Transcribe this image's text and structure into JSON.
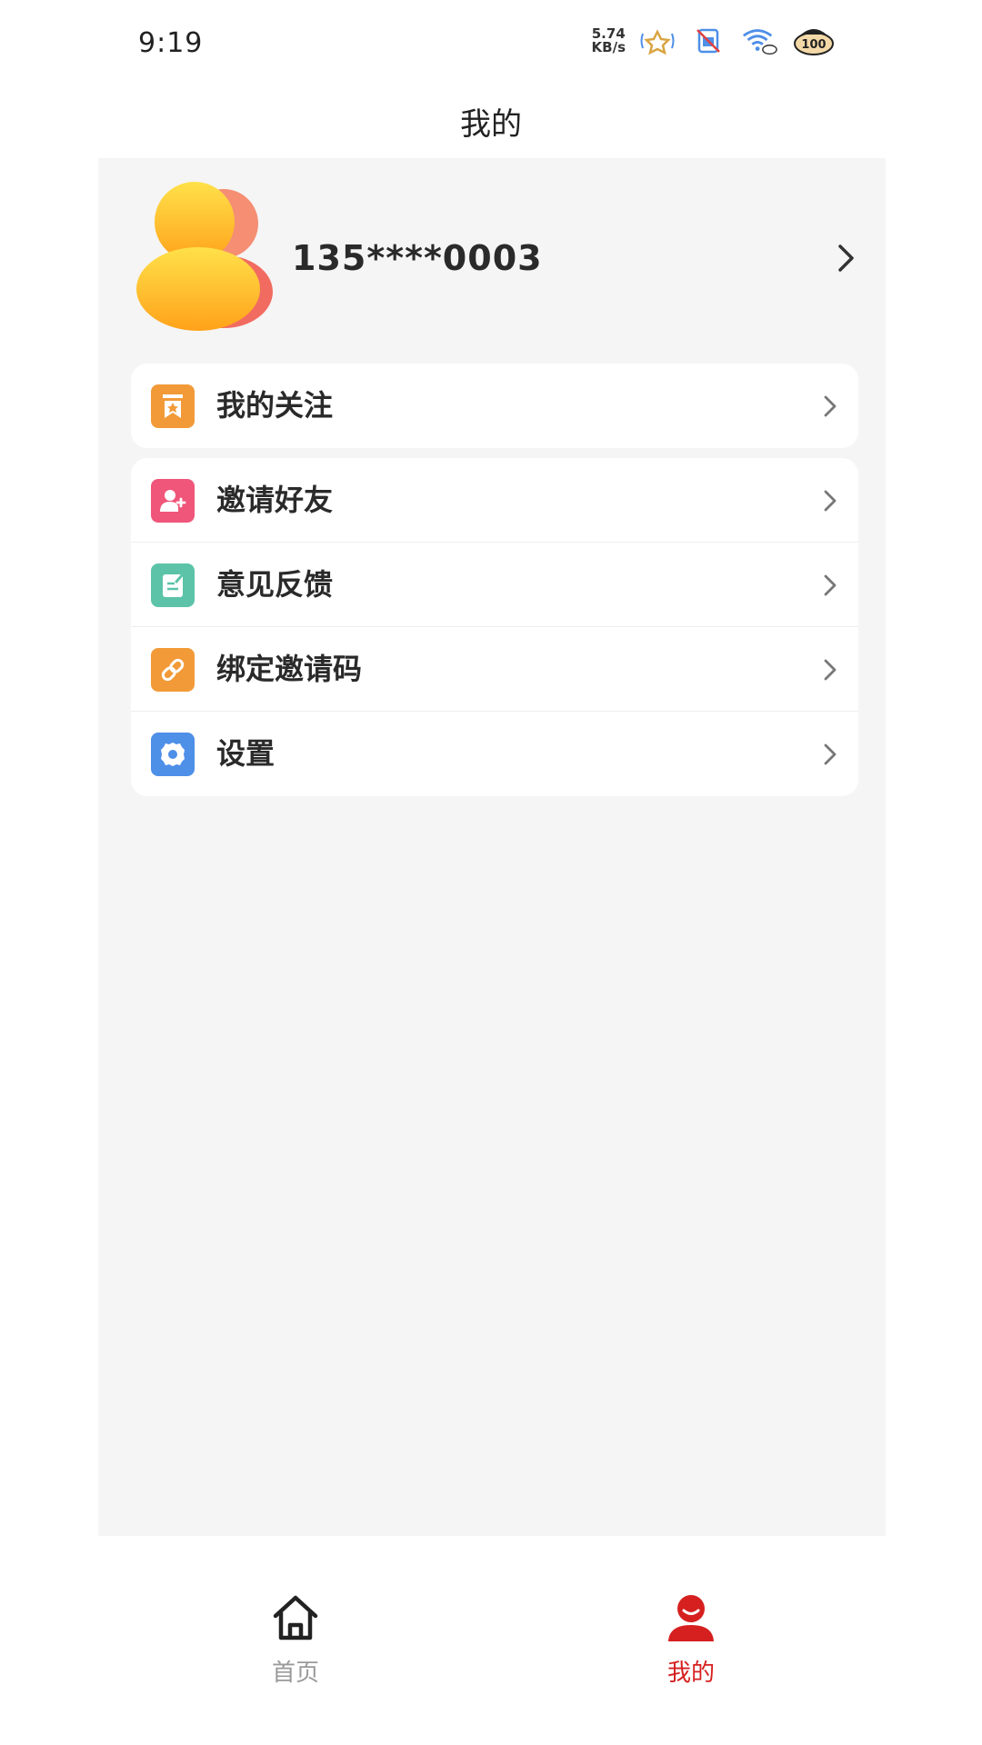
{
  "status_bar": {
    "time": "9:19",
    "net_speed_value": "5.74",
    "net_speed_unit": "KB/s",
    "battery": "100"
  },
  "header": {
    "title": "我的"
  },
  "profile": {
    "phone": "135****0003"
  },
  "menu_group_1": [
    {
      "label": "我的关注",
      "icon": "bookmark-icon",
      "color": "#F29A38"
    }
  ],
  "menu_group_2": [
    {
      "label": "邀请好友",
      "icon": "add-user-icon",
      "color": "#F0567A"
    },
    {
      "label": "意见反馈",
      "icon": "feedback-icon",
      "color": "#5CC3A8"
    },
    {
      "label": "绑定邀请码",
      "icon": "link-icon",
      "color": "#F29A38"
    },
    {
      "label": "设置",
      "icon": "gear-icon",
      "color": "#4E8FE8"
    }
  ],
  "tabbar": {
    "home": {
      "label": "首页",
      "icon": "home-icon",
      "color": "#9a9a9a"
    },
    "mine": {
      "label": "我的",
      "icon": "user-icon",
      "color": "#D62020",
      "active": true
    }
  }
}
